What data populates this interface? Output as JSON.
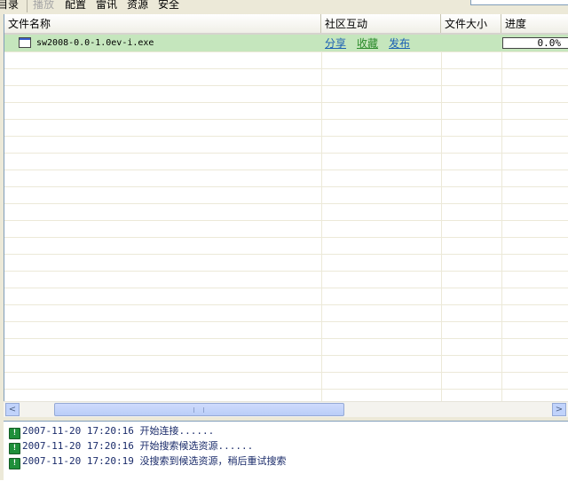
{
  "menu": {
    "items": [
      {
        "label": "目录",
        "enabled": true
      },
      {
        "label": "播放",
        "enabled": false
      },
      {
        "label": "配置",
        "enabled": true
      },
      {
        "label": "雷讯",
        "enabled": true
      },
      {
        "label": "资源",
        "enabled": true
      },
      {
        "label": "安全",
        "enabled": true
      }
    ]
  },
  "columns": [
    "文件名称",
    "社区互动",
    "文件大小",
    "进度"
  ],
  "rows": [
    {
      "filename": "sw2008-0.0-1.0ev-i.exe",
      "actions": [
        "分享",
        "收藏",
        "发布"
      ],
      "size": "",
      "progress_text": "0.0%",
      "progress_fraction": 0.0
    }
  ],
  "scrollbar": {
    "left_arrow": "<",
    "right_arrow": ">"
  },
  "log": [
    {
      "text": "2007-11-20 17:20:16 开始连接......"
    },
    {
      "text": "2007-11-20 17:20:16 开始搜索候选资源......"
    },
    {
      "text": "2007-11-20 17:20:19 没搜索到候选资源，稍后重试搜索"
    }
  ],
  "colors": {
    "selected_row": "#c5e6bd",
    "link_blue": "#1a5fb4",
    "link_green": "#2a8a2a",
    "chrome": "#ece9d8"
  },
  "icons": {
    "file": "file-icon",
    "log": "info-icon"
  }
}
